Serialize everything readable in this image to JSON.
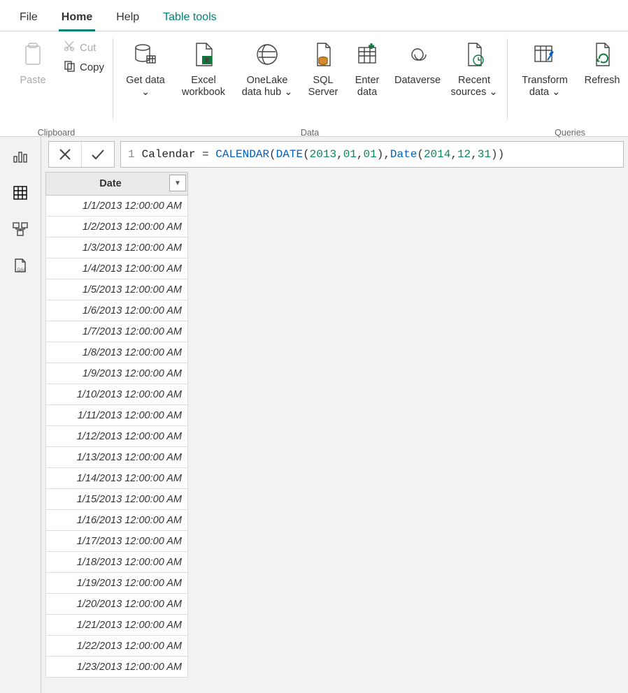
{
  "tabs": {
    "file": "File",
    "home": "Home",
    "help": "Help",
    "tabletools": "Table tools"
  },
  "ribbon": {
    "clipboard": {
      "label": "Clipboard",
      "paste": "Paste",
      "cut": "Cut",
      "copy": "Copy"
    },
    "data": {
      "label": "Data",
      "getdata": "Get data",
      "excel": "Excel workbook",
      "onelake": "OneLake data hub",
      "sql": "SQL Server",
      "enter": "Enter data",
      "dataverse": "Dataverse",
      "recent": "Recent sources"
    },
    "queries": {
      "label": "Queries",
      "transform": "Transform data",
      "refresh": "Refresh"
    }
  },
  "formula": {
    "line": "1",
    "tokens": [
      {
        "t": "Calendar ",
        "c": "fn"
      },
      {
        "t": "= ",
        "c": "punct"
      },
      {
        "t": "CALENDAR",
        "c": "kw"
      },
      {
        "t": "(",
        "c": "punct"
      },
      {
        "t": "DATE",
        "c": "kw"
      },
      {
        "t": "(",
        "c": "punct"
      },
      {
        "t": "2013",
        "c": "num"
      },
      {
        "t": ",",
        "c": "punct"
      },
      {
        "t": "01",
        "c": "num"
      },
      {
        "t": ",",
        "c": "punct"
      },
      {
        "t": "01",
        "c": "num"
      },
      {
        "t": ")",
        "c": "punct"
      },
      {
        "t": ",",
        "c": "punct"
      },
      {
        "t": "Date",
        "c": "kw"
      },
      {
        "t": "(",
        "c": "punct"
      },
      {
        "t": "2014",
        "c": "num"
      },
      {
        "t": ",",
        "c": "punct"
      },
      {
        "t": "12",
        "c": "num"
      },
      {
        "t": ",",
        "c": "punct"
      },
      {
        "t": "31",
        "c": "num"
      },
      {
        "t": "))",
        "c": "punct"
      }
    ]
  },
  "table": {
    "header": "Date",
    "rows": [
      "1/1/2013 12:00:00 AM",
      "1/2/2013 12:00:00 AM",
      "1/3/2013 12:00:00 AM",
      "1/4/2013 12:00:00 AM",
      "1/5/2013 12:00:00 AM",
      "1/6/2013 12:00:00 AM",
      "1/7/2013 12:00:00 AM",
      "1/8/2013 12:00:00 AM",
      "1/9/2013 12:00:00 AM",
      "1/10/2013 12:00:00 AM",
      "1/11/2013 12:00:00 AM",
      "1/12/2013 12:00:00 AM",
      "1/13/2013 12:00:00 AM",
      "1/14/2013 12:00:00 AM",
      "1/15/2013 12:00:00 AM",
      "1/16/2013 12:00:00 AM",
      "1/17/2013 12:00:00 AM",
      "1/18/2013 12:00:00 AM",
      "1/19/2013 12:00:00 AM",
      "1/20/2013 12:00:00 AM",
      "1/21/2013 12:00:00 AM",
      "1/22/2013 12:00:00 AM",
      "1/23/2013 12:00:00 AM"
    ]
  }
}
